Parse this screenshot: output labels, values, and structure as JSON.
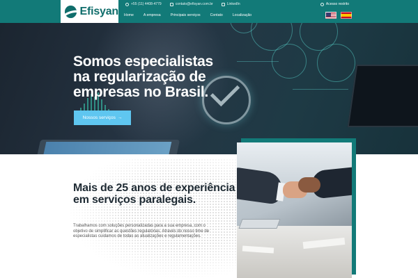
{
  "brand": {
    "name": "Efisyan",
    "color": "#127a78"
  },
  "topbar": {
    "phone": "+55 (11) 4408-4779",
    "email": "contato@efisyan.com.br",
    "linkedin": "LinkedIn",
    "access": "Acesso restrito"
  },
  "nav": {
    "items": [
      "Home",
      "A empresa",
      "Principais serviços",
      "Contato",
      "Localização"
    ]
  },
  "languages": [
    "English",
    "Español"
  ],
  "hero": {
    "title": "Somos especialistas na regularização de empresas no Brasil.",
    "button_label": "Nossos serviços",
    "button_arrow": "→",
    "button_color": "#5fc6f0"
  },
  "about": {
    "title": "Mais de 25 anos de experiência em serviços paralegais.",
    "text": "Trabalhamos com soluções personalizadas para a sua empresa, com o objetivo de simplificar as questões regulatórias. Através do nosso time de especialistas cuidamos de todas as atualizações e regulamentações."
  },
  "icons": {
    "phone": "phone-icon",
    "email": "mail-icon",
    "linkedin": "linkedin-icon",
    "access": "user-icon",
    "check": "check-circle-icon"
  }
}
